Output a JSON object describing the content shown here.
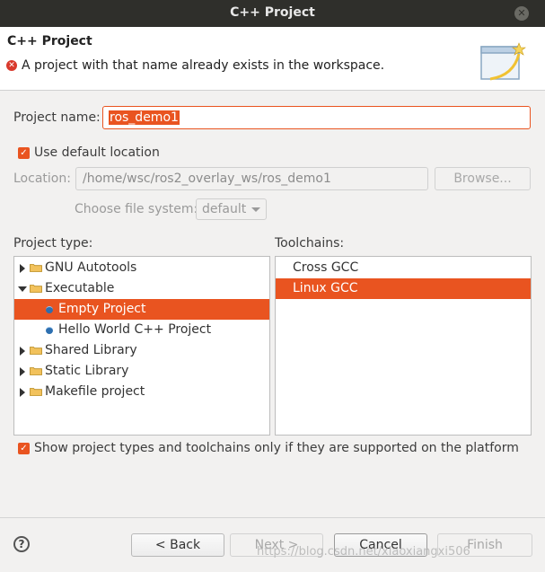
{
  "window": {
    "title": "C++ Project"
  },
  "header": {
    "title": "C++ Project",
    "error_message": "A project with that name already exists in the workspace."
  },
  "project_name": {
    "label": "Project name:",
    "value": "ros_demo1"
  },
  "use_default_location": {
    "label": "Use default location",
    "checked": true
  },
  "location": {
    "label": "Location:",
    "value": "/home/wsc/ros2_overlay_ws/ros_demo1",
    "browse_label": "Browse..."
  },
  "file_system": {
    "label": "Choose file system:",
    "value": "default"
  },
  "project_type": {
    "label": "Project type:",
    "items": [
      {
        "label": "GNU Autotools",
        "kind": "folder",
        "expanded": false,
        "level": 0
      },
      {
        "label": "Executable",
        "kind": "folder",
        "expanded": true,
        "level": 0
      },
      {
        "label": "Empty Project",
        "kind": "item",
        "level": 1,
        "selected": true
      },
      {
        "label": "Hello World C++ Project",
        "kind": "item",
        "level": 1
      },
      {
        "label": "Shared Library",
        "kind": "folder",
        "expanded": false,
        "level": 0
      },
      {
        "label": "Static Library",
        "kind": "folder",
        "expanded": false,
        "level": 0
      },
      {
        "label": "Makefile project",
        "kind": "folder",
        "expanded": false,
        "level": 0
      }
    ]
  },
  "toolchains": {
    "label": "Toolchains:",
    "items": [
      {
        "label": "Cross GCC",
        "selected": false
      },
      {
        "label": "Linux GCC",
        "selected": true
      }
    ]
  },
  "show_supported": {
    "label": "Show project types and toolchains only if they are supported on the platform",
    "checked": true
  },
  "buttons": {
    "back": "< Back",
    "next": "Next >",
    "cancel": "Cancel",
    "finish": "Finish"
  },
  "help_icon": "help-icon",
  "watermark": "https://blog.csdn.net/xiaoxiangxi506",
  "colors": {
    "accent": "#e95420",
    "titlebar": "#2f2f2b"
  }
}
